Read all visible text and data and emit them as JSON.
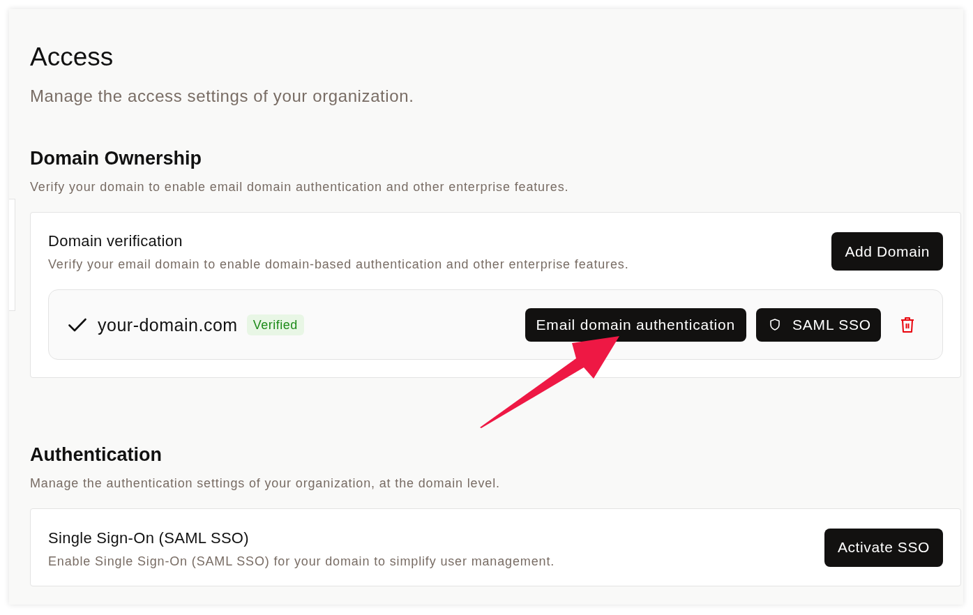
{
  "page": {
    "title": "Access",
    "subtitle": "Manage the access settings of your organization."
  },
  "sections": [
    {
      "heading": "Domain Ownership",
      "description": "Verify your domain to enable email domain authentication and other enterprise features.",
      "card": {
        "title": "Domain verification",
        "description": "Verify your email domain to enable domain-based authentication and other enterprise features.",
        "button": "Add Domain",
        "domains": [
          {
            "name": "your-domain.com",
            "verified": true,
            "badge": "Verified",
            "actions": [
              {
                "kind": "plain",
                "label": "Email domain authentication"
              },
              {
                "kind": "shield",
                "label": "SAML SSO"
              }
            ]
          }
        ]
      }
    },
    {
      "heading": "Authentication",
      "description": "Manage the authentication settings of your organization, at the domain level.",
      "card": {
        "title": "Single Sign-On (SAML SSO)",
        "description": "Enable Single Sign-On (SAML SSO) for your domain to simplify user management.",
        "button": "Activate SSO"
      }
    }
  ],
  "annotations": [
    {
      "kind": "arrow"
    }
  ]
}
